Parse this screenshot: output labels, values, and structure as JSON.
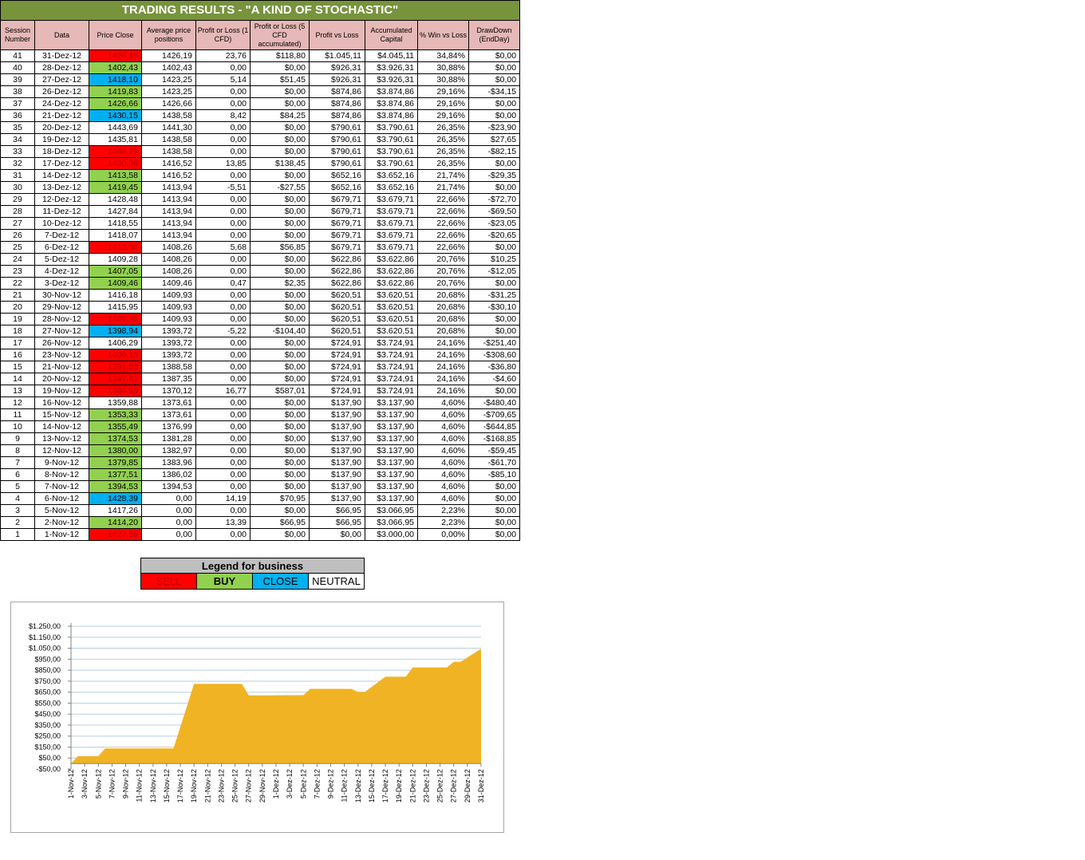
{
  "title": "TRADING RESULTS - \"A KIND OF STOCHASTIC\"",
  "headers": [
    "Session Number",
    "Data",
    "Price Close",
    "Average price positions",
    "Profit or Loss (1 CFD)",
    "Profit or Loss (5 CFD accumulated)",
    "Profit vs Loss",
    "Accumulated Capital",
    "% Win vs Loss",
    "DrawDown (EndDay)"
  ],
  "rows": [
    [
      "41",
      "31-Dez-12",
      "1426,19",
      "1426,19",
      "23,76",
      "$118,80",
      "$1.045,11",
      "$4.045,11",
      "34,84%",
      "$0,00",
      "sell"
    ],
    [
      "40",
      "28-Dez-12",
      "1402,43",
      "1402,43",
      "0,00",
      "$0,00",
      "$926,31",
      "$3.926,31",
      "30,88%",
      "$0,00",
      "buy"
    ],
    [
      "39",
      "27-Dez-12",
      "1418,10",
      "1423,25",
      "5,14",
      "$51,45",
      "$926,31",
      "$3.926,31",
      "30,88%",
      "$0,00",
      "close"
    ],
    [
      "38",
      "26-Dez-12",
      "1419,83",
      "1423,25",
      "0,00",
      "$0,00",
      "$874,86",
      "$3.874,86",
      "29,16%",
      "-$34,15",
      "buy"
    ],
    [
      "37",
      "24-Dez-12",
      "1426,66",
      "1426,66",
      "0,00",
      "$0,00",
      "$874,86",
      "$3.874,86",
      "29,16%",
      "$0,00",
      "buy"
    ],
    [
      "36",
      "21-Dez-12",
      "1430,15",
      "1438,58",
      "8,42",
      "$84,25",
      "$874,86",
      "$3.874,86",
      "29,16%",
      "$0,00",
      "close"
    ],
    [
      "35",
      "20-Dez-12",
      "1443,69",
      "1441,30",
      "0,00",
      "$0,00",
      "$790,61",
      "$3.790,61",
      "26,35%",
      "-$23,90",
      "none"
    ],
    [
      "34",
      "19-Dez-12",
      "1435,81",
      "1438,58",
      "0,00",
      "$0,00",
      "$790,61",
      "$3.790,61",
      "26,35%",
      "$27,65",
      "none"
    ],
    [
      "33",
      "18-Dez-12",
      "1446,79",
      "1438,58",
      "0,00",
      "$0,00",
      "$790,61",
      "$3.790,61",
      "26,35%",
      "-$82,15",
      "sell"
    ],
    [
      "32",
      "17-Dez-12",
      "1430,36",
      "1416,52",
      "13,85",
      "$138,45",
      "$790,61",
      "$3.790,61",
      "26,35%",
      "$0,00",
      "sell"
    ],
    [
      "31",
      "14-Dez-12",
      "1413,58",
      "1416,52",
      "0,00",
      "$0,00",
      "$652,16",
      "$3.652,16",
      "21,74%",
      "-$29,35",
      "buy"
    ],
    [
      "30",
      "13-Dez-12",
      "1419,45",
      "1413,94",
      "-5,51",
      "-$27,55",
      "$652,16",
      "$3.652,16",
      "21,74%",
      "$0,00",
      "buy"
    ],
    [
      "29",
      "12-Dez-12",
      "1428,48",
      "1413,94",
      "0,00",
      "$0,00",
      "$679,71",
      "$3.679,71",
      "22,66%",
      "-$72,70",
      "none"
    ],
    [
      "28",
      "11-Dez-12",
      "1427,84",
      "1413,94",
      "0,00",
      "$0,00",
      "$679,71",
      "$3.679,71",
      "22,66%",
      "-$69,50",
      "none"
    ],
    [
      "27",
      "10-Dez-12",
      "1418,55",
      "1413,94",
      "0,00",
      "$0,00",
      "$679,71",
      "$3.679,71",
      "22,66%",
      "-$23,05",
      "none"
    ],
    [
      "26",
      "7-Dez-12",
      "1418,07",
      "1413,94",
      "0,00",
      "$0,00",
      "$679,71",
      "$3.679,71",
      "22,66%",
      "-$20,65",
      "none"
    ],
    [
      "25",
      "6-Dez-12",
      "1413,94",
      "1408,26",
      "5,68",
      "$56,85",
      "$679,71",
      "$3.679,71",
      "22,66%",
      "$0,00",
      "sell"
    ],
    [
      "24",
      "5-Dez-12",
      "1409,28",
      "1408,26",
      "0,00",
      "$0,00",
      "$622,86",
      "$3.622,86",
      "20,76%",
      "$10,25",
      "none"
    ],
    [
      "23",
      "4-Dez-12",
      "1407,05",
      "1408,26",
      "0,00",
      "$0,00",
      "$622,86",
      "$3.622,86",
      "20,76%",
      "-$12,05",
      "buy"
    ],
    [
      "22",
      "3-Dez-12",
      "1409,46",
      "1409,46",
      "0,47",
      "$2,35",
      "$622,86",
      "$3.622,86",
      "20,76%",
      "$0,00",
      "buy"
    ],
    [
      "21",
      "30-Nov-12",
      "1416,18",
      "1409,93",
      "0,00",
      "$0,00",
      "$620,51",
      "$3.620,51",
      "20,68%",
      "-$31,25",
      "none"
    ],
    [
      "20",
      "29-Nov-12",
      "1415,95",
      "1409,93",
      "0,00",
      "$0,00",
      "$620,51",
      "$3.620,51",
      "20,68%",
      "-$30,10",
      "none"
    ],
    [
      "19",
      "28-Nov-12",
      "1409,93",
      "1409,93",
      "0,00",
      "$0,00",
      "$620,51",
      "$3.620,51",
      "20,68%",
      "$0,00",
      "sell"
    ],
    [
      "18",
      "27-Nov-12",
      "1398,94",
      "1393,72",
      "-5,22",
      "-$104,40",
      "$620,51",
      "$3.620,51",
      "20,68%",
      "$0,00",
      "close"
    ],
    [
      "17",
      "26-Nov-12",
      "1406,29",
      "1393,72",
      "0,00",
      "$0,00",
      "$724,91",
      "$3.724,91",
      "24,16%",
      "-$251,40",
      "none"
    ],
    [
      "16",
      "23-Nov-12",
      "1409,15",
      "1393,72",
      "0,00",
      "$0,00",
      "$724,91",
      "$3.724,91",
      "24,16%",
      "-$308,60",
      "sell"
    ],
    [
      "15",
      "21-Nov-12",
      "1391,03",
      "1388,58",
      "0,00",
      "$0,00",
      "$724,91",
      "$3.724,91",
      "24,16%",
      "-$36,80",
      "sell"
    ],
    [
      "14",
      "20-Nov-12",
      "1387,81",
      "1387,35",
      "0,00",
      "$0,00",
      "$724,91",
      "$3.724,91",
      "24,16%",
      "-$4,60",
      "sell"
    ],
    [
      "13",
      "19-Nov-12",
      "1386,89",
      "1370,12",
      "16,77",
      "$587,01",
      "$724,91",
      "$3.724,91",
      "24,16%",
      "$0,00",
      "sell"
    ],
    [
      "12",
      "16-Nov-12",
      "1359,88",
      "1373,61",
      "0,00",
      "$0,00",
      "$137,90",
      "$3.137,90",
      "4,60%",
      "-$480,40",
      "none"
    ],
    [
      "11",
      "15-Nov-12",
      "1353,33",
      "1373,61",
      "0,00",
      "$0,00",
      "$137,90",
      "$3.137,90",
      "4,60%",
      "-$709,65",
      "buy"
    ],
    [
      "10",
      "14-Nov-12",
      "1355,49",
      "1376,99",
      "0,00",
      "$0,00",
      "$137,90",
      "$3.137,90",
      "4,60%",
      "-$644,85",
      "buy"
    ],
    [
      "9",
      "13-Nov-12",
      "1374,53",
      "1381,28",
      "0,00",
      "$0,00",
      "$137,90",
      "$3.137,90",
      "4,60%",
      "-$168,85",
      "buy"
    ],
    [
      "8",
      "12-Nov-12",
      "1380,00",
      "1382,97",
      "0,00",
      "$0,00",
      "$137,90",
      "$3.137,90",
      "4,60%",
      "-$59,45",
      "buy"
    ],
    [
      "7",
      "9-Nov-12",
      "1379,85",
      "1383,96",
      "0,00",
      "$0,00",
      "$137,90",
      "$3.137,90",
      "4,60%",
      "-$61,70",
      "buy"
    ],
    [
      "6",
      "8-Nov-12",
      "1377,51",
      "1386,02",
      "0,00",
      "$0,00",
      "$137,90",
      "$3.137,90",
      "4,60%",
      "-$85,10",
      "buy"
    ],
    [
      "5",
      "7-Nov-12",
      "1394,53",
      "1394,53",
      "0,00",
      "$0,00",
      "$137,90",
      "$3.137,90",
      "4,60%",
      "$0,00",
      "buy"
    ],
    [
      "4",
      "6-Nov-12",
      "1428,39",
      "0,00",
      "14,19",
      "$70,95",
      "$137,90",
      "$3.137,90",
      "4,60%",
      "$0,00",
      "close"
    ],
    [
      "3",
      "5-Nov-12",
      "1417,26",
      "0,00",
      "0,00",
      "$0,00",
      "$66,95",
      "$3.066,95",
      "2,23%",
      "$0,00",
      "none"
    ],
    [
      "2",
      "2-Nov-12",
      "1414,20",
      "0,00",
      "13,39",
      "$66,95",
      "$66,95",
      "$3.066,95",
      "2,23%",
      "$0,00",
      "buy"
    ],
    [
      "1",
      "1-Nov-12",
      "1427,59",
      "0,00",
      "0,00",
      "$0,00",
      "$0,00",
      "$3.000,00",
      "0,00%",
      "$0,00",
      "sell"
    ]
  ],
  "legend": {
    "title": "Legend for business",
    "sell": "SELL",
    "buy": "BUY",
    "close": "CLOSE",
    "neutral": "NEUTRAL"
  },
  "colors": {
    "header_green": "#77933c",
    "header_pink": "#e6b8b7",
    "sell": "#ff0000",
    "buy": "#92d050",
    "close": "#00b0f0",
    "area_fill": "#f0b323",
    "gridline": "#b9cde5"
  },
  "chart_data": {
    "type": "area",
    "x": [
      "1-Nov-12",
      "2-Nov-12",
      "5-Nov-12",
      "6-Nov-12",
      "7-Nov-12",
      "8-Nov-12",
      "9-Nov-12",
      "12-Nov-12",
      "13-Nov-12",
      "14-Nov-12",
      "15-Nov-12",
      "16-Nov-12",
      "19-Nov-12",
      "20-Nov-12",
      "21-Nov-12",
      "23-Nov-12",
      "26-Nov-12",
      "27-Nov-12",
      "28-Nov-12",
      "29-Nov-12",
      "30-Nov-12",
      "3-Dez-12",
      "4-Dez-12",
      "5-Dez-12",
      "6-Dez-12",
      "7-Dez-12",
      "10-Dez-12",
      "11-Dez-12",
      "12-Dez-12",
      "13-Dez-12",
      "14-Dez-12",
      "17-Dez-12",
      "18-Dez-12",
      "19-Dez-12",
      "20-Dez-12",
      "21-Dez-12",
      "24-Dez-12",
      "26-Dez-12",
      "27-Dez-12",
      "28-Dez-12",
      "31-Dez-12"
    ],
    "values": [
      0,
      66.95,
      66.95,
      137.9,
      137.9,
      137.9,
      137.9,
      137.9,
      137.9,
      137.9,
      137.9,
      137.9,
      724.91,
      724.91,
      724.91,
      724.91,
      724.91,
      620.51,
      620.51,
      620.51,
      620.51,
      622.86,
      622.86,
      622.86,
      679.71,
      679.71,
      679.71,
      679.71,
      679.71,
      652.16,
      652.16,
      790.61,
      790.61,
      790.61,
      790.61,
      874.86,
      874.86,
      874.86,
      926.31,
      926.31,
      1045.11
    ],
    "y_ticks": [
      "-$50,00",
      "$50,00",
      "$150,00",
      "$250,00",
      "$350,00",
      "$450,00",
      "$550,00",
      "$650,00",
      "$750,00",
      "$850,00",
      "$950,00",
      "$1.050,00",
      "$1.150,00",
      "$1.250,00"
    ],
    "x_ticks": [
      "1-Nov-12",
      "3-Nov-12",
      "5-Nov-12",
      "7-Nov-12",
      "9-Nov-12",
      "11-Nov-12",
      "13-Nov-12",
      "15-Nov-12",
      "17-Nov-12",
      "19-Nov-12",
      "21-Nov-12",
      "23-Nov-12",
      "25-Nov-12",
      "27-Nov-12",
      "29-Nov-12",
      "1-Dez-12",
      "3-Dez-12",
      "5-Dez-12",
      "7-Dez-12",
      "9-Dez-12",
      "11-Dez-12",
      "13-Dez-12",
      "15-Dez-12",
      "17-Dez-12",
      "19-Dez-12",
      "21-Dez-12",
      "23-Dez-12",
      "25-Dez-12",
      "27-Dez-12",
      "29-Dez-12",
      "31-Dez-12"
    ],
    "ylim": [
      -50,
      1250
    ],
    "x_axis": "date",
    "grid": true,
    "legend": "none"
  }
}
